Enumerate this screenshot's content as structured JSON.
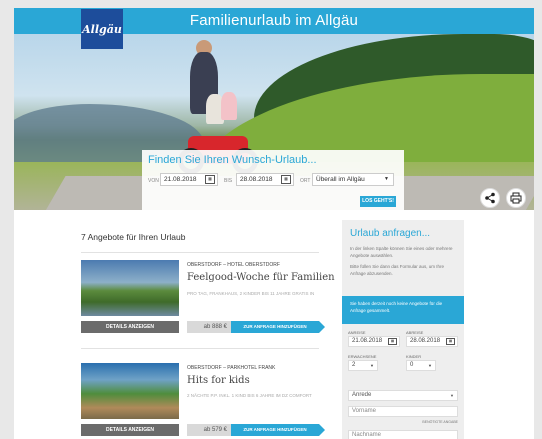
{
  "header": {
    "title": "Familienurlaub im Allgäu",
    "logo_text": "Allgäu"
  },
  "search": {
    "title": "Finden Sie Ihren Wunsch-Urlaub...",
    "from_label": "von",
    "from_value": "21.08.2018",
    "to_label": "bis",
    "to_value": "28.08.2018",
    "place_label": "ort",
    "place_value": "Überall im Allgäu",
    "submit_label": "LOS GEHT'S!"
  },
  "offers": {
    "heading": "7 Angebote für Ihren Urlaub",
    "items": [
      {
        "location": "OBERSTDORF – HOTEL OBERSTDORF",
        "name": "Feelgood-Woche für Familien",
        "desc": "PRO TAG, FRANKHAUS, 2 KINDER BIS 11 JAHRE GRATIS IN",
        "details_label": "DETAILS ANZEIGEN",
        "price": "ab 888 €",
        "add_label": "ZUR ANFRAGE HINZUFÜGEN"
      },
      {
        "location": "OBERSTDORF – PARKHOTEL FRANK",
        "name": "Hits for kids",
        "desc": "2 NÄCHTE P.P. INKL. 1 KIND BIS 6 JAHRE IM DZ COMFORT",
        "details_label": "DETAILS ANZEIGEN",
        "price": "ab 579 €",
        "add_label": "ZUR ANFRAGE HINZUFÜGEN"
      }
    ]
  },
  "sidebar": {
    "title": "Urlaub anfragen...",
    "para1": "In der linken Spalte können Sie eines oder mehrere Angebote auswählen.",
    "para2": "Bitte füllen Sie dann das Formular aus, um Ihre Anfrage abzusenden.",
    "note": "Sie haben derzeit noch keine Angebote für die Anfrage gesammelt.",
    "arrival_label": "ANREISE",
    "arrival_value": "21.08.2018",
    "departure_label": "ABREISE",
    "departure_value": "28.08.2018",
    "adults_label": "ERWACHSENE",
    "adults_value": "2",
    "children_label": "KINDER",
    "children_value": "0",
    "salutation_placeholder": "Anrede",
    "firstname_placeholder": "Vorname",
    "mandatory_note": "BENÖTIGTE ANGABE",
    "lastname_placeholder": "Nachname"
  },
  "icons": {
    "share": "share-icon",
    "print": "print-icon",
    "calendar": "calendar-icon"
  },
  "colors": {
    "accent": "#2aa7d6",
    "logo": "#1d4d9b"
  }
}
